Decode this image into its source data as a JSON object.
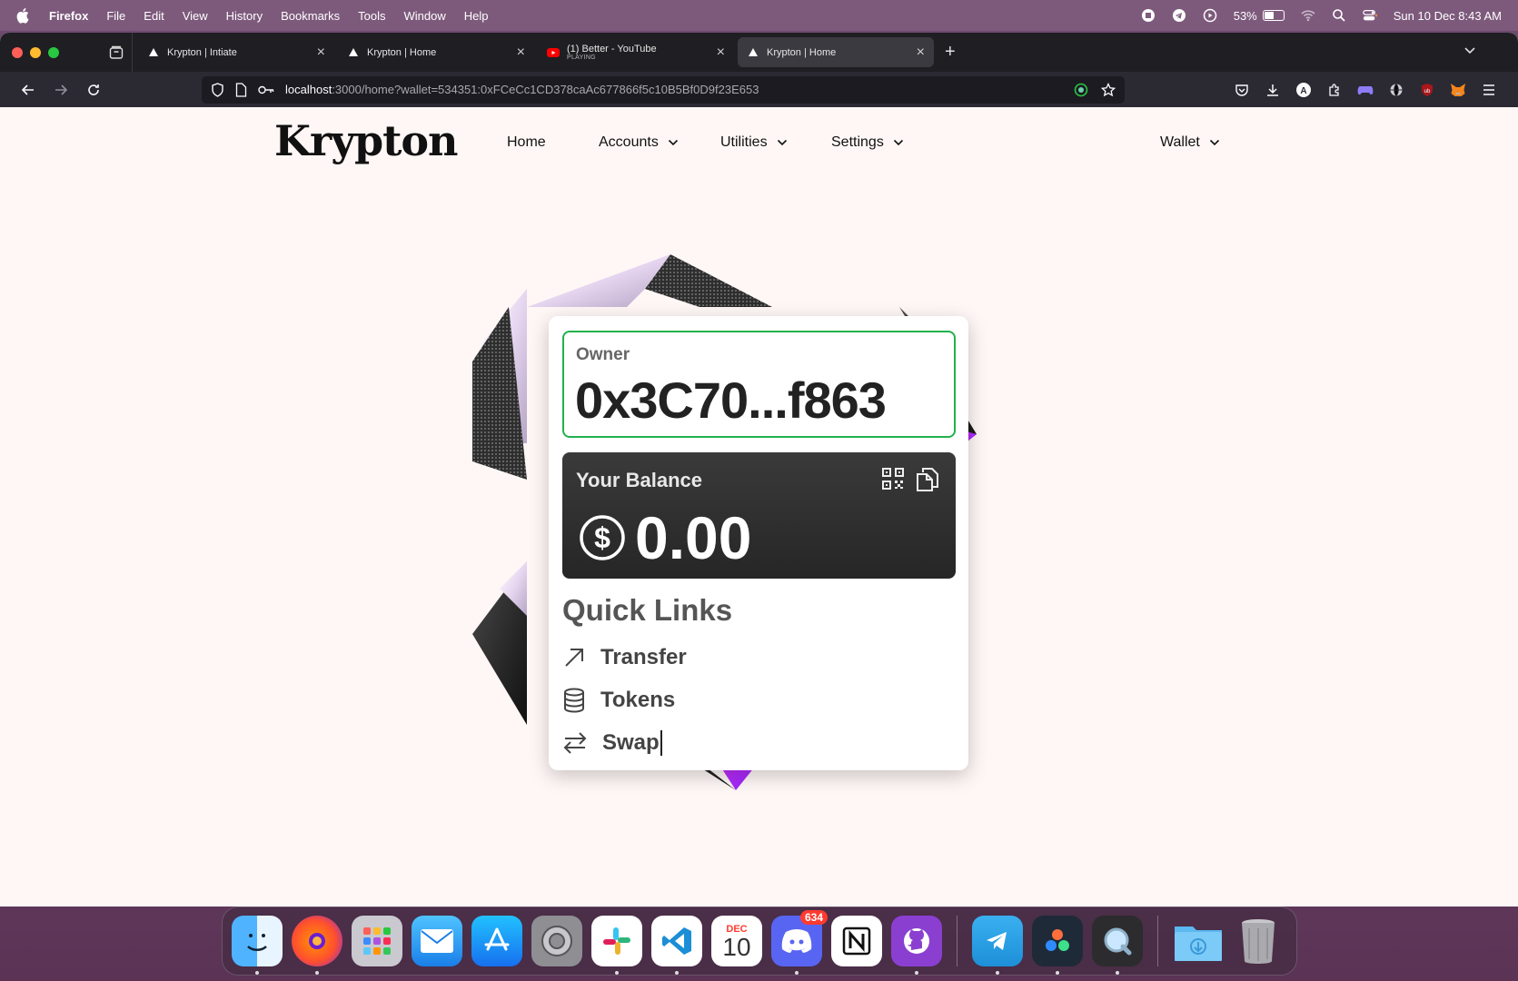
{
  "menubar": {
    "app": "Firefox",
    "items": [
      "File",
      "Edit",
      "View",
      "History",
      "Bookmarks",
      "Tools",
      "Window",
      "Help"
    ],
    "battery_percent": "53%",
    "battery_level": 0.53,
    "datetime": "Sun 10 Dec  8:43 AM"
  },
  "browser": {
    "tabs": [
      {
        "title": "Krypton | Intiate",
        "active": false
      },
      {
        "title": "Krypton | Home",
        "active": false
      },
      {
        "title": "(1) Better - YouTube",
        "subtitle": "PLAYING",
        "active": false
      },
      {
        "title": "Krypton | Home",
        "active": true
      }
    ],
    "url_host": "localhost",
    "url_rest": ":3000/home?wallet=534351:0xFCeCc1CD378caAc677866f5c10B5Bf0D9f23E653"
  },
  "site": {
    "logo": "Krypton",
    "nav": {
      "home": "Home",
      "accounts": "Accounts",
      "utilities": "Utilities",
      "settings": "Settings",
      "wallet": "Wallet"
    }
  },
  "card": {
    "owner_label": "Owner",
    "owner_address": "0x3C70...f863",
    "balance_label": "Your Balance",
    "balance_value": "0.00",
    "quick_links_title": "Quick Links",
    "quick_links": [
      "Transfer",
      "Tokens",
      "Swap"
    ]
  },
  "dock": {
    "discord_badge": "634",
    "calendar_month": "DEC",
    "calendar_day": "10"
  },
  "colors": {
    "owner_border": "#22b14c",
    "accent_magenta": "#e62be6"
  }
}
